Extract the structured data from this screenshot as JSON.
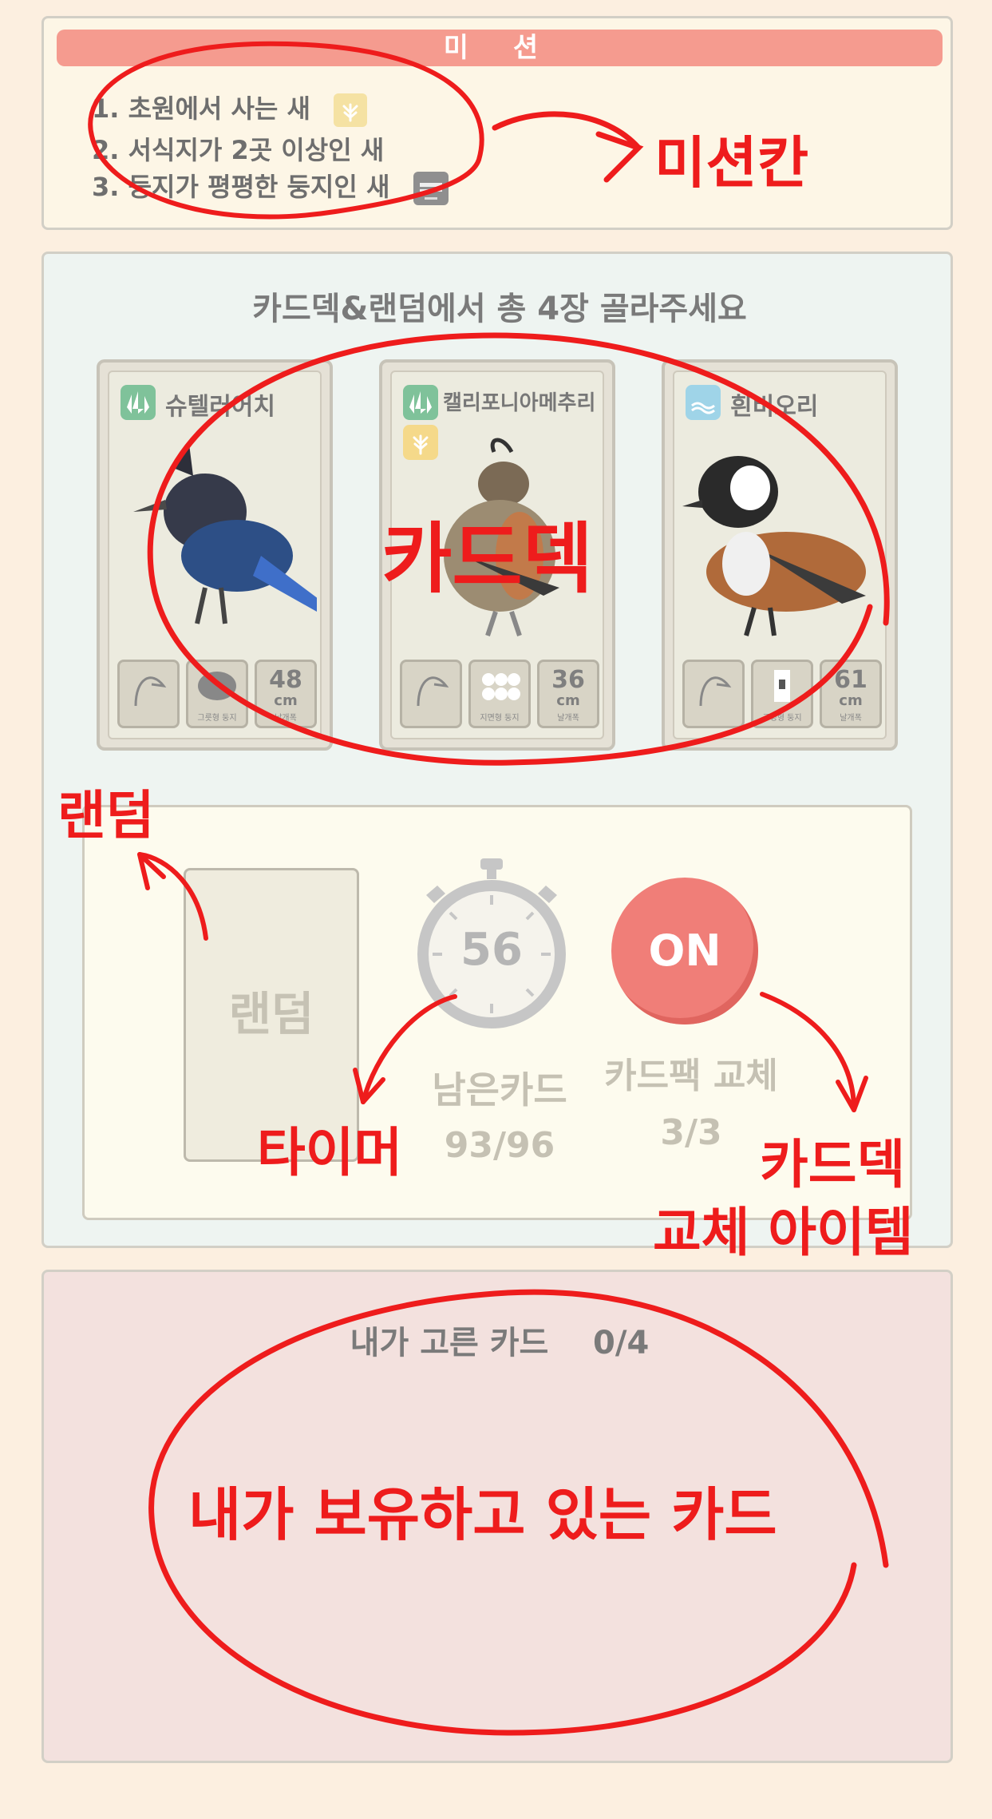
{
  "mission": {
    "header": "미 션",
    "items": [
      "1. 초원에서 사는 새",
      "2. 서식지가 2곳 이상인 새",
      "3. 둥지가 평평한 둥지인 새"
    ]
  },
  "deck": {
    "instruction": "카드덱&랜덤에서 총 4장 골라주세요",
    "cards": [
      {
        "name": "슈텔러어치",
        "size": "48",
        "unit": "cm",
        "habitat_icon": "forest-icon",
        "stat_caps": [
          "",
          "그릇형 둥지",
          "날개폭"
        ]
      },
      {
        "name": "캘리포니아메추리",
        "size": "36",
        "unit": "cm",
        "habitat_icon": "forest-icon",
        "stat_caps": [
          "",
          "지면형 둥지",
          "날개폭"
        ]
      },
      {
        "name": "흰비오리",
        "size": "61",
        "unit": "cm",
        "habitat_icon": "wetland-icon",
        "stat_caps": [
          "",
          "구멍형 둥지",
          "날개폭"
        ]
      }
    ]
  },
  "controls": {
    "random_label": "랜덤",
    "timer_value": "56",
    "remaining_label": "남은카드",
    "remaining_value": "93/96",
    "swap_button": "ON",
    "swap_label": "카드팩 교체",
    "swap_value": "3/3"
  },
  "hand": {
    "title": "내가 고른 카드    0/4"
  },
  "annotations": {
    "mission": "미션칸",
    "deck": "카드덱",
    "random": "랜덤",
    "timer": "타이머",
    "swap_line1": "카드덱",
    "swap_line2": "교체 아이템",
    "hand": "내가 보유하고 있는 카드"
  },
  "colors": {
    "annotation_red": "#ee1c1c",
    "mission_header": "#f59b8f",
    "on_button": "#f07e78",
    "background": "#fcefe0"
  }
}
